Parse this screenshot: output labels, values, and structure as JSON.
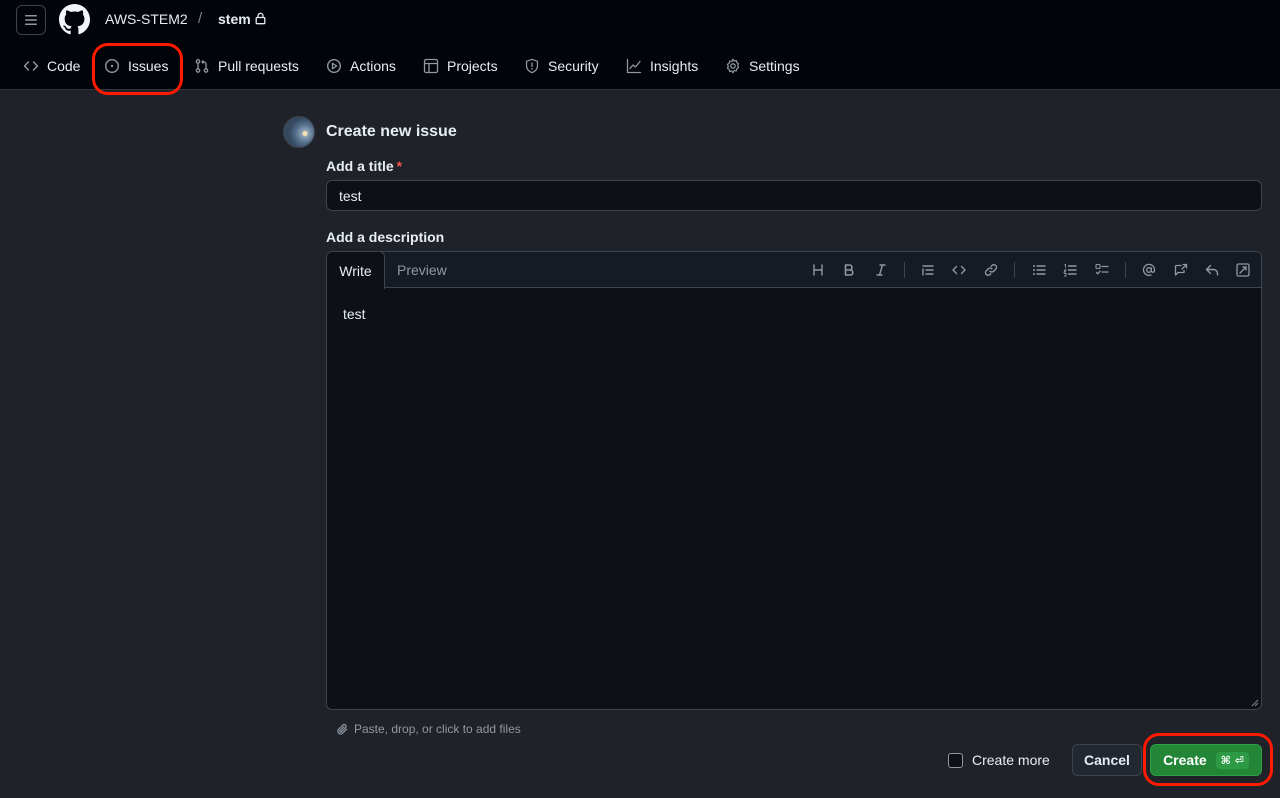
{
  "header": {
    "owner": "AWS-STEM2",
    "separator": "/",
    "repo": "stem",
    "icons": [
      "hamburger-icon",
      "github-logo-icon",
      "lock-icon"
    ]
  },
  "nav": {
    "tabs": [
      {
        "label": "Code",
        "icon": "code-icon"
      },
      {
        "label": "Issues",
        "icon": "issue-opened-icon",
        "highlighted": true
      },
      {
        "label": "Pull requests",
        "icon": "git-pull-request-icon"
      },
      {
        "label": "Actions",
        "icon": "play-icon"
      },
      {
        "label": "Projects",
        "icon": "table-icon"
      },
      {
        "label": "Security",
        "icon": "shield-icon"
      },
      {
        "label": "Insights",
        "icon": "graph-icon"
      },
      {
        "label": "Settings",
        "icon": "gear-icon"
      }
    ]
  },
  "form": {
    "heading": "Create new issue",
    "title_label": "Add a title",
    "required_mark": "*",
    "title_value": "test",
    "description_label": "Add a description",
    "write_tab": "Write",
    "preview_tab": "Preview",
    "description_value": "test",
    "toolbar": [
      "heading-icon",
      "bold-icon",
      "italic-icon",
      "quote-icon",
      "code-icon",
      "link-icon",
      "unordered-list-icon",
      "ordered-list-icon",
      "tasklist-icon",
      "mention-icon",
      "cross-reference-icon",
      "reply-icon",
      "fullscreen-icon"
    ],
    "attach_hint": "Paste, drop, or click to add files",
    "create_more_label": "Create more",
    "cancel_label": "Cancel",
    "create_label": "Create",
    "create_shortcut": "⌘ ⏎"
  },
  "colors": {
    "accent_highlight": "#ff1a00",
    "primary_button": "#238636",
    "background": "#1f2329"
  }
}
